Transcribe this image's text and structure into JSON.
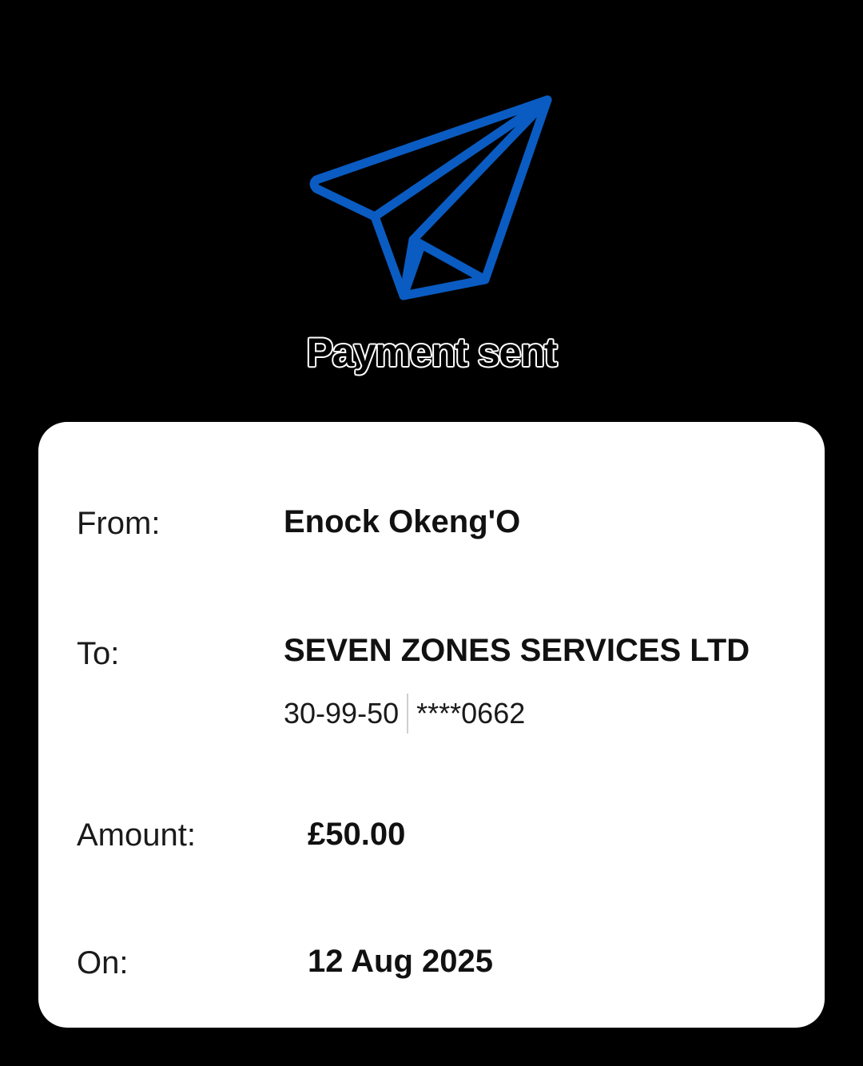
{
  "status": {
    "title": "Payment sent",
    "icon": "paper-plane-icon",
    "icon_color": "#0a5cc2"
  },
  "details": {
    "from": {
      "label": "From:",
      "value": "Enock Okeng'O"
    },
    "to": {
      "label": "To:",
      "value": "SEVEN ZONES SERVICES LTD",
      "sort_code": "30-99-50",
      "account_number": "****0662"
    },
    "amount": {
      "label": "Amount:",
      "value": "£50.00"
    },
    "on": {
      "label": "On:",
      "value": "12 Aug 2025"
    }
  },
  "colors": {
    "background": "#000000",
    "card": "#ffffff",
    "accent": "#0a5cc2"
  }
}
